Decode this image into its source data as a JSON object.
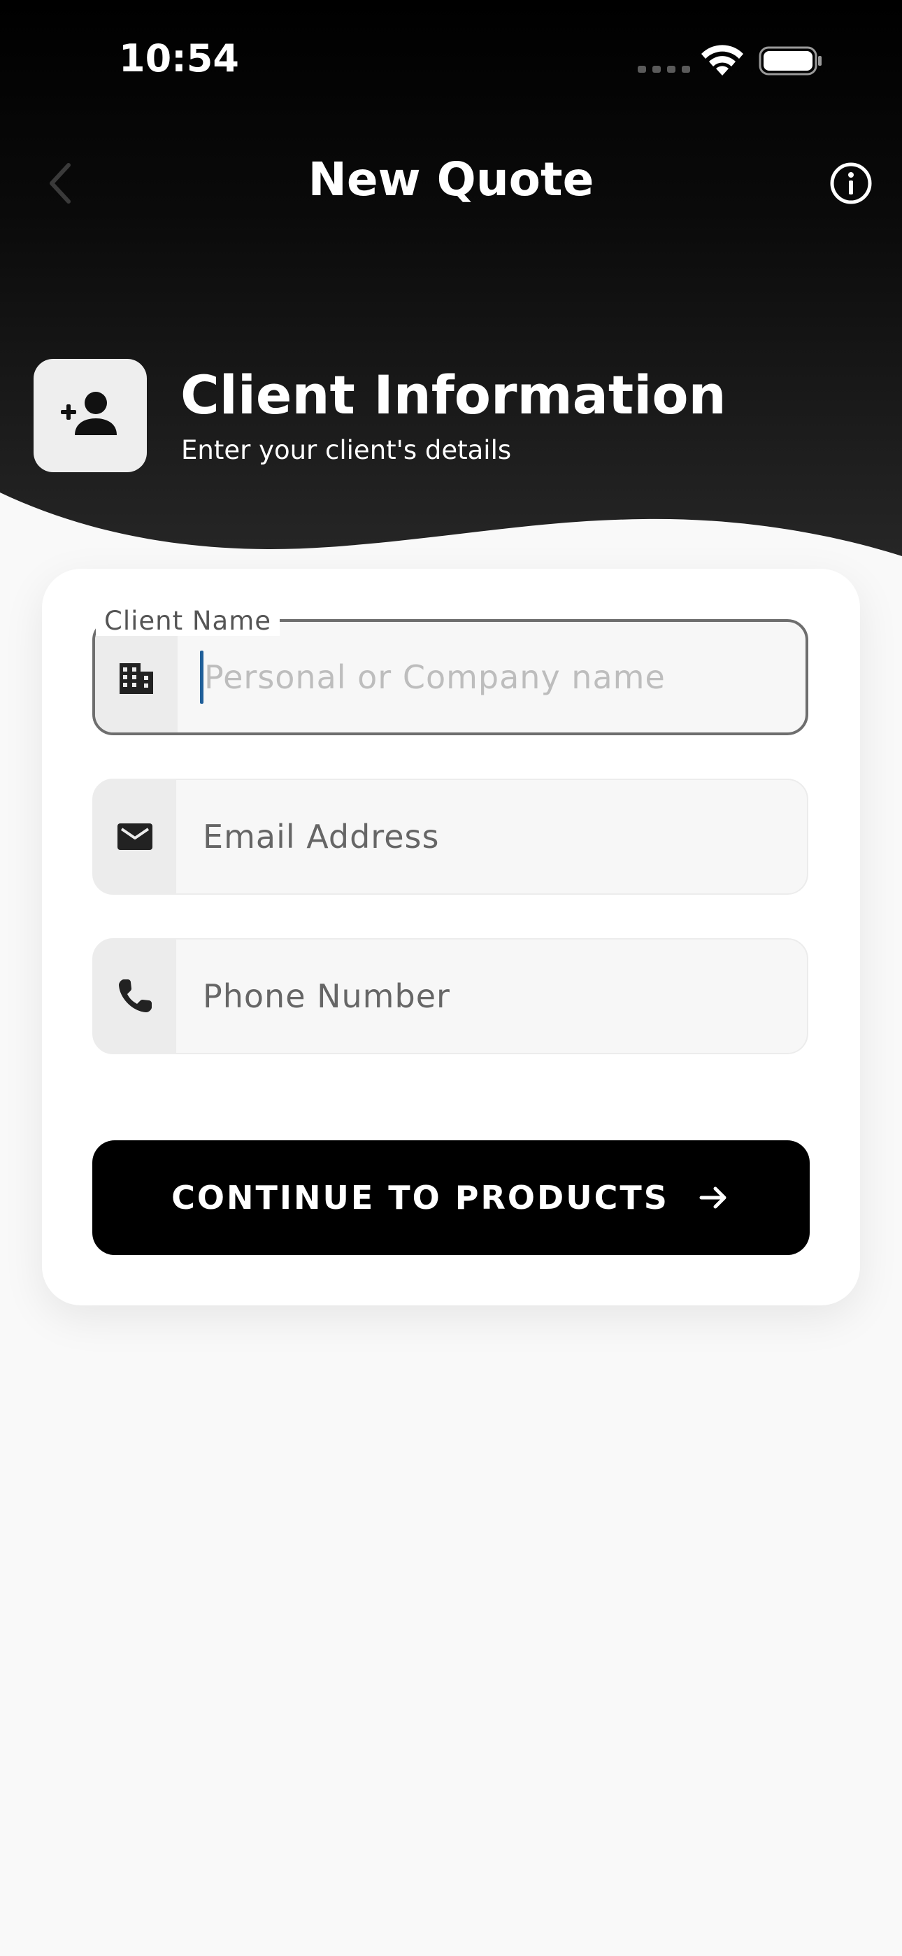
{
  "status_bar": {
    "time": "10:54"
  },
  "nav": {
    "title": "New Quote",
    "back_icon": "chevron-left-icon",
    "info_icon": "info-circle-icon"
  },
  "section": {
    "icon": "person-add-icon",
    "title": "Client Information",
    "subtitle": "Enter your client's details"
  },
  "form": {
    "client_name": {
      "label": "Client Name",
      "placeholder": "Personal or Company name",
      "value": "",
      "icon": "building-icon",
      "focused": true
    },
    "email": {
      "placeholder": "Email Address",
      "value": "",
      "icon": "mail-icon"
    },
    "phone": {
      "placeholder": "Phone Number",
      "value": "",
      "icon": "phone-icon"
    },
    "continue_button": {
      "label": "CONTINUE TO PRODUCTS",
      "icon": "arrow-right-icon"
    }
  },
  "colors": {
    "header_top": "#000000",
    "header_bottom": "#222222",
    "page_background": "#f9f9f9",
    "card_background": "#ffffff",
    "primary_button": "#000000",
    "caret": "#1f5f99"
  }
}
